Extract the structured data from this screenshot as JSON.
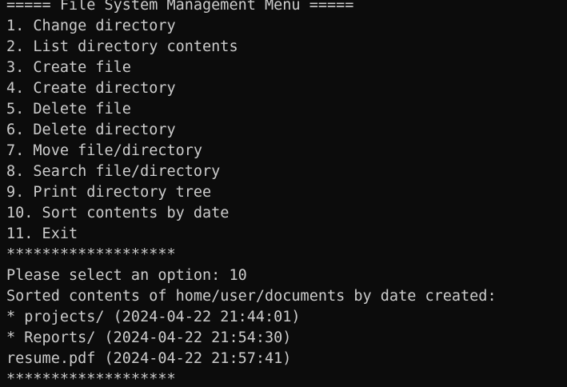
{
  "terminal": {
    "colors": {
      "background": "#0c0c0c",
      "foreground": "#cccccc"
    },
    "lines": [
      "===== File System Management Menu =====",
      "1. Change directory",
      "2. List directory contents",
      "3. Create file",
      "4. Create directory",
      "5. Delete file",
      "6. Delete directory",
      "7. Move file/directory",
      "8. Search file/directory",
      "9. Print directory tree",
      "10. Sort contents by date",
      "11. Exit",
      "*******************",
      "Please select an option: 10",
      "Sorted contents of home/user/documents by date created:",
      "* projects/ (2024-04-22 21:44:01)",
      "* Reports/ (2024-04-22 21:54:30)",
      "resume.pdf (2024-04-22 21:57:41)",
      "*******************"
    ]
  }
}
